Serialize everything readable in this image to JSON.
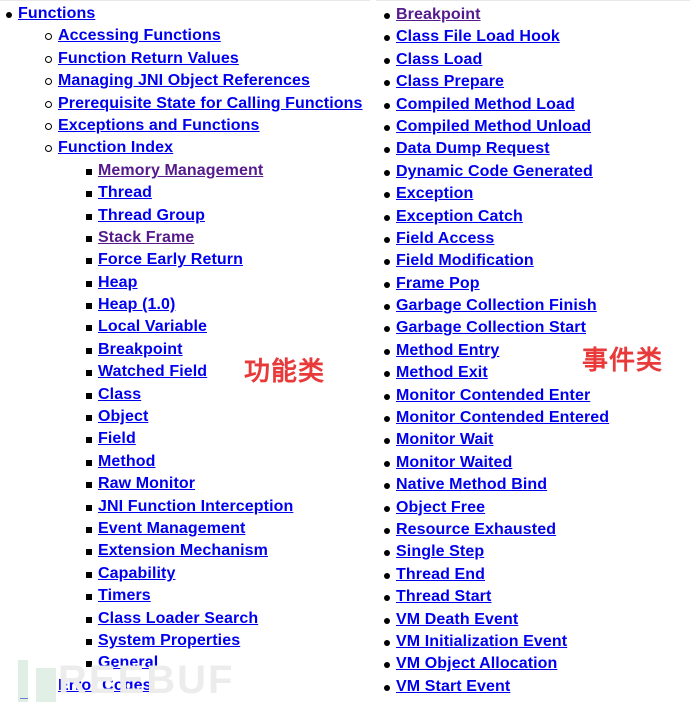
{
  "functions_panel": {
    "root": {
      "label": "Functions"
    },
    "sections": [
      {
        "label": "Accessing Functions"
      },
      {
        "label": "Function Return Values"
      },
      {
        "label": "Managing JNI Object References"
      },
      {
        "label": "Prerequisite State for Calling Functions"
      },
      {
        "label": "Exceptions and Functions"
      },
      {
        "label": "Function Index"
      }
    ],
    "function_index": [
      {
        "label": "Memory Management",
        "visited": true
      },
      {
        "label": "Thread",
        "visited": false
      },
      {
        "label": "Thread Group",
        "visited": false
      },
      {
        "label": "Stack Frame",
        "visited": true
      },
      {
        "label": "Force Early Return",
        "visited": false
      },
      {
        "label": "Heap",
        "visited": false
      },
      {
        "label": "Heap (1.0)",
        "visited": false
      },
      {
        "label": "Local Variable",
        "visited": false
      },
      {
        "label": "Breakpoint",
        "visited": false
      },
      {
        "label": "Watched Field",
        "visited": false
      },
      {
        "label": "Class",
        "visited": false
      },
      {
        "label": "Object",
        "visited": false
      },
      {
        "label": "Field",
        "visited": false
      },
      {
        "label": "Method",
        "visited": false
      },
      {
        "label": "Raw Monitor",
        "visited": false
      },
      {
        "label": "JNI Function Interception",
        "visited": false
      },
      {
        "label": "Event Management",
        "visited": false
      },
      {
        "label": "Extension Mechanism",
        "visited": false
      },
      {
        "label": "Capability",
        "visited": false
      },
      {
        "label": "Timers",
        "visited": false
      },
      {
        "label": "Class Loader Search",
        "visited": false
      },
      {
        "label": "System Properties",
        "visited": false
      },
      {
        "label": "General",
        "visited": false
      }
    ],
    "trailing_section": {
      "label": "Error Codes"
    },
    "annotation": "功能类"
  },
  "events_panel": {
    "events": [
      {
        "label": "Breakpoint",
        "visited": true
      },
      {
        "label": "Class File Load Hook",
        "visited": false
      },
      {
        "label": "Class Load",
        "visited": false
      },
      {
        "label": "Class Prepare",
        "visited": false
      },
      {
        "label": "Compiled Method Load",
        "visited": false
      },
      {
        "label": "Compiled Method Unload",
        "visited": false
      },
      {
        "label": "Data Dump Request",
        "visited": false
      },
      {
        "label": "Dynamic Code Generated",
        "visited": false
      },
      {
        "label": "Exception",
        "visited": false
      },
      {
        "label": "Exception Catch",
        "visited": false
      },
      {
        "label": "Field Access",
        "visited": false
      },
      {
        "label": "Field Modification",
        "visited": false
      },
      {
        "label": "Frame Pop",
        "visited": false
      },
      {
        "label": "Garbage Collection Finish",
        "visited": false
      },
      {
        "label": "Garbage Collection Start",
        "visited": false
      },
      {
        "label": "Method Entry",
        "visited": false
      },
      {
        "label": "Method Exit",
        "visited": false
      },
      {
        "label": "Monitor Contended Enter",
        "visited": false
      },
      {
        "label": "Monitor Contended Entered",
        "visited": false
      },
      {
        "label": "Monitor Wait",
        "visited": false
      },
      {
        "label": "Monitor Waited",
        "visited": false
      },
      {
        "label": "Native Method Bind",
        "visited": false
      },
      {
        "label": "Object Free",
        "visited": false
      },
      {
        "label": "Resource Exhausted",
        "visited": false
      },
      {
        "label": "Single Step",
        "visited": false
      },
      {
        "label": "Thread End",
        "visited": false
      },
      {
        "label": "Thread Start",
        "visited": false
      },
      {
        "label": "VM Death Event",
        "visited": false
      },
      {
        "label": "VM Initialization Event",
        "visited": false
      },
      {
        "label": "VM Object Allocation",
        "visited": false
      },
      {
        "label": "VM Start Event",
        "visited": false
      }
    ],
    "annotation": "事件类"
  },
  "watermark": {
    "text": "REEBUF"
  },
  "colors": {
    "link": "#0000ee",
    "visited_link": "#551a8b",
    "annotation": "#e83a3a"
  }
}
